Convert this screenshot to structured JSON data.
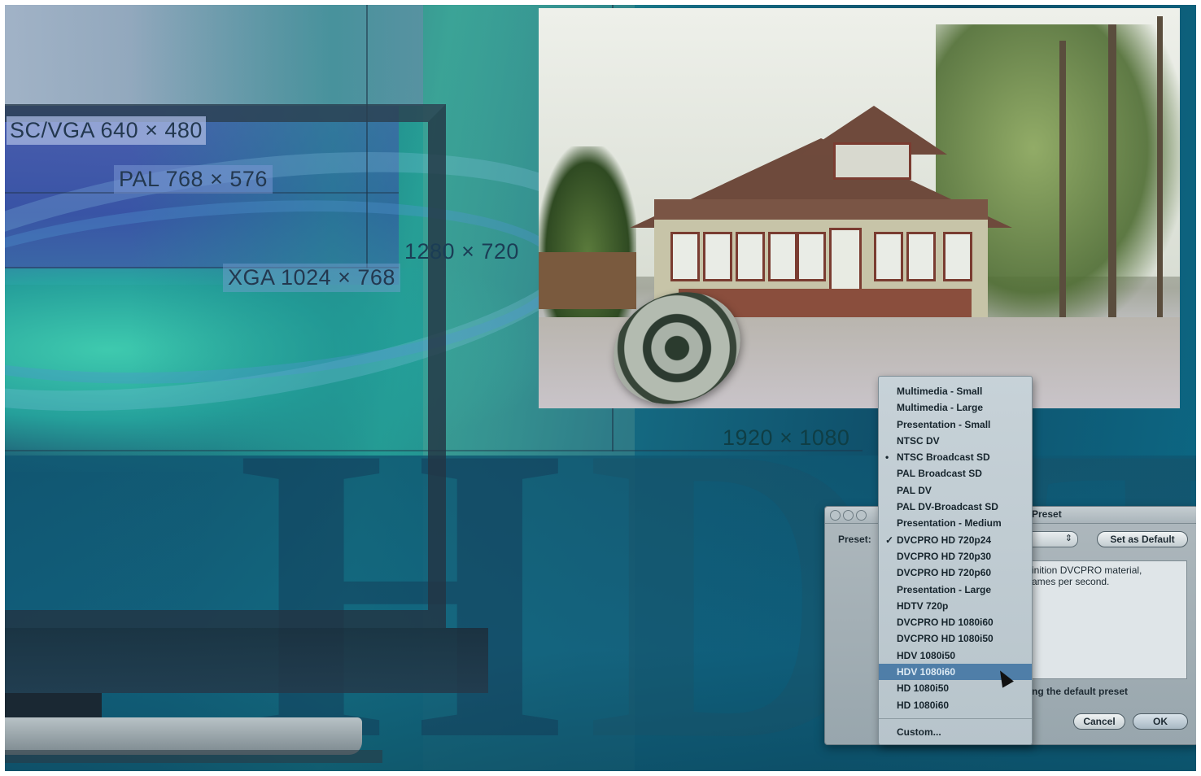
{
  "resolutions": {
    "vga": "SC/VGA 640 × 480",
    "pal": "PAL 768 × 576",
    "xga": "XGA 1024 × 768",
    "hd720": "1280 × 720",
    "hd1080": "1920 × 1080"
  },
  "background_letters": [
    "H",
    "D",
    "T"
  ],
  "dialog": {
    "title": "Preset",
    "preset_label": "Preset:",
    "popup_arrows": "⇕",
    "set_default_button": "Set as Default",
    "description_lines": [
      "inition DVCPRO material,",
      "ames per second."
    ],
    "default_preset_text": "ng the default preset",
    "cancel_button": "Cancel",
    "ok_button": "OK"
  },
  "menu": {
    "items": [
      {
        "label": "Multimedia - Small",
        "mark": ""
      },
      {
        "label": "Multimedia - Large",
        "mark": ""
      },
      {
        "label": "Presentation - Small",
        "mark": ""
      },
      {
        "label": "NTSC DV",
        "mark": ""
      },
      {
        "label": "NTSC Broadcast SD",
        "mark": "•"
      },
      {
        "label": "PAL Broadcast SD",
        "mark": ""
      },
      {
        "label": "PAL DV",
        "mark": ""
      },
      {
        "label": "PAL DV-Broadcast SD",
        "mark": ""
      },
      {
        "label": "Presentation - Medium",
        "mark": ""
      },
      {
        "label": "DVCPRO HD 720p24",
        "mark": "✓"
      },
      {
        "label": "DVCPRO HD 720p30",
        "mark": ""
      },
      {
        "label": "DVCPRO HD 720p60",
        "mark": ""
      },
      {
        "label": "Presentation - Large",
        "mark": ""
      },
      {
        "label": "HDTV 720p",
        "mark": ""
      },
      {
        "label": "DVCPRO HD 1080i60",
        "mark": ""
      },
      {
        "label": "DVCPRO HD 1080i50",
        "mark": ""
      },
      {
        "label": "HDV 1080i50",
        "mark": ""
      },
      {
        "label": "HDV 1080i60",
        "mark": "",
        "highlighted": true
      },
      {
        "label": "HD 1080i50",
        "mark": ""
      },
      {
        "label": "HD 1080i60",
        "mark": ""
      }
    ],
    "custom": "Custom..."
  },
  "colors": {
    "menu_highlight": "#4f7ea8",
    "background_teal": "#0f5f7c"
  }
}
